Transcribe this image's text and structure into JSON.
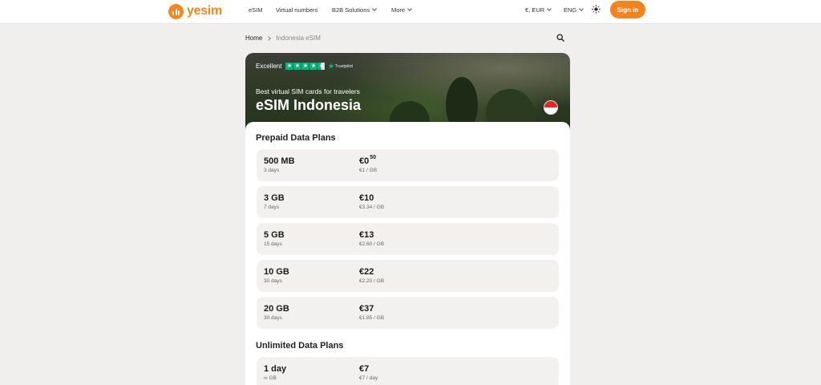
{
  "header": {
    "logo_text": "yesim",
    "nav": [
      "eSIM",
      "Virtual numbers",
      "B2B Solutions",
      "More"
    ],
    "currency": "€, EUR",
    "language": "ENG",
    "sign_in": "Sign in"
  },
  "breadcrumb": {
    "home": "Home",
    "current": "Indonesia eSIM"
  },
  "hero": {
    "rating_label": "Excellent",
    "rating_brand": "Trustpilot",
    "rating_stars": 4.5,
    "subtitle": "Best virtual SIM cards for travelers",
    "title": "eSIM Indonesia"
  },
  "prepaid": {
    "title": "Prepaid Data Plans",
    "plans": [
      {
        "data": "500 MB",
        "days": "3 days",
        "price": "€0",
        "price_cents": "50",
        "unit_price": "€1 / GB"
      },
      {
        "data": "3 GB",
        "days": "7 days",
        "price": "€10",
        "price_cents": "",
        "unit_price": "€3.34 / GB"
      },
      {
        "data": "5 GB",
        "days": "15 days",
        "price": "€13",
        "price_cents": "",
        "unit_price": "€2.60 / GB"
      },
      {
        "data": "10 GB",
        "days": "30 days",
        "price": "€22",
        "price_cents": "",
        "unit_price": "€2.20 / GB"
      },
      {
        "data": "20 GB",
        "days": "30 days",
        "price": "€37",
        "price_cents": "",
        "unit_price": "€1.85 / GB"
      }
    ]
  },
  "unlimited": {
    "title": "Unlimited Data Plans",
    "plans": [
      {
        "data": "1 day",
        "days": "∞ GB",
        "price": "€7",
        "unit_price": "€7 / day"
      }
    ]
  },
  "colors": {
    "accent": "#f5831b",
    "trustpilot": "#00b67a",
    "background": "#f0efed"
  }
}
